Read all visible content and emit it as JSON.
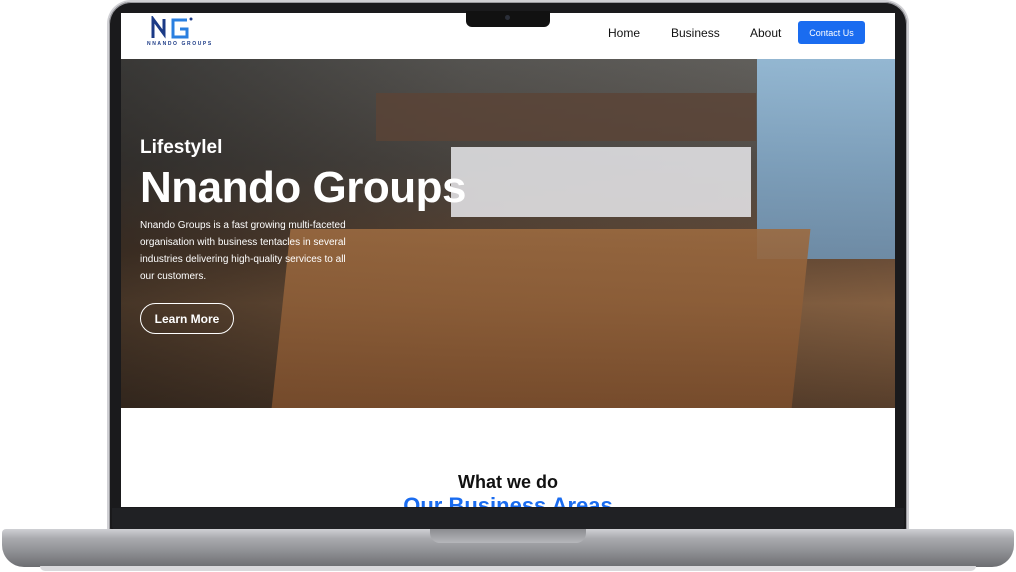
{
  "brand": {
    "logo_letters": "NG",
    "logo_text": "NNANDO GROUPS",
    "color": "#1b3a86"
  },
  "nav": {
    "links": [
      "Home",
      "Business",
      "About"
    ],
    "cta_label": "Contact Us"
  },
  "hero": {
    "subtitle": "Lifestylel",
    "title": "Nnando Groups",
    "description": "Nnando Groups is a fast growing multi-faceted organisation with business tentacles in several industries delivering high-quality services to all our customers.",
    "button_label": "Learn More"
  },
  "section": {
    "title": "What we do",
    "subtitle": "Our Business Areas"
  },
  "colors": {
    "accent": "#1a6cf0",
    "text_dark": "#111111"
  }
}
